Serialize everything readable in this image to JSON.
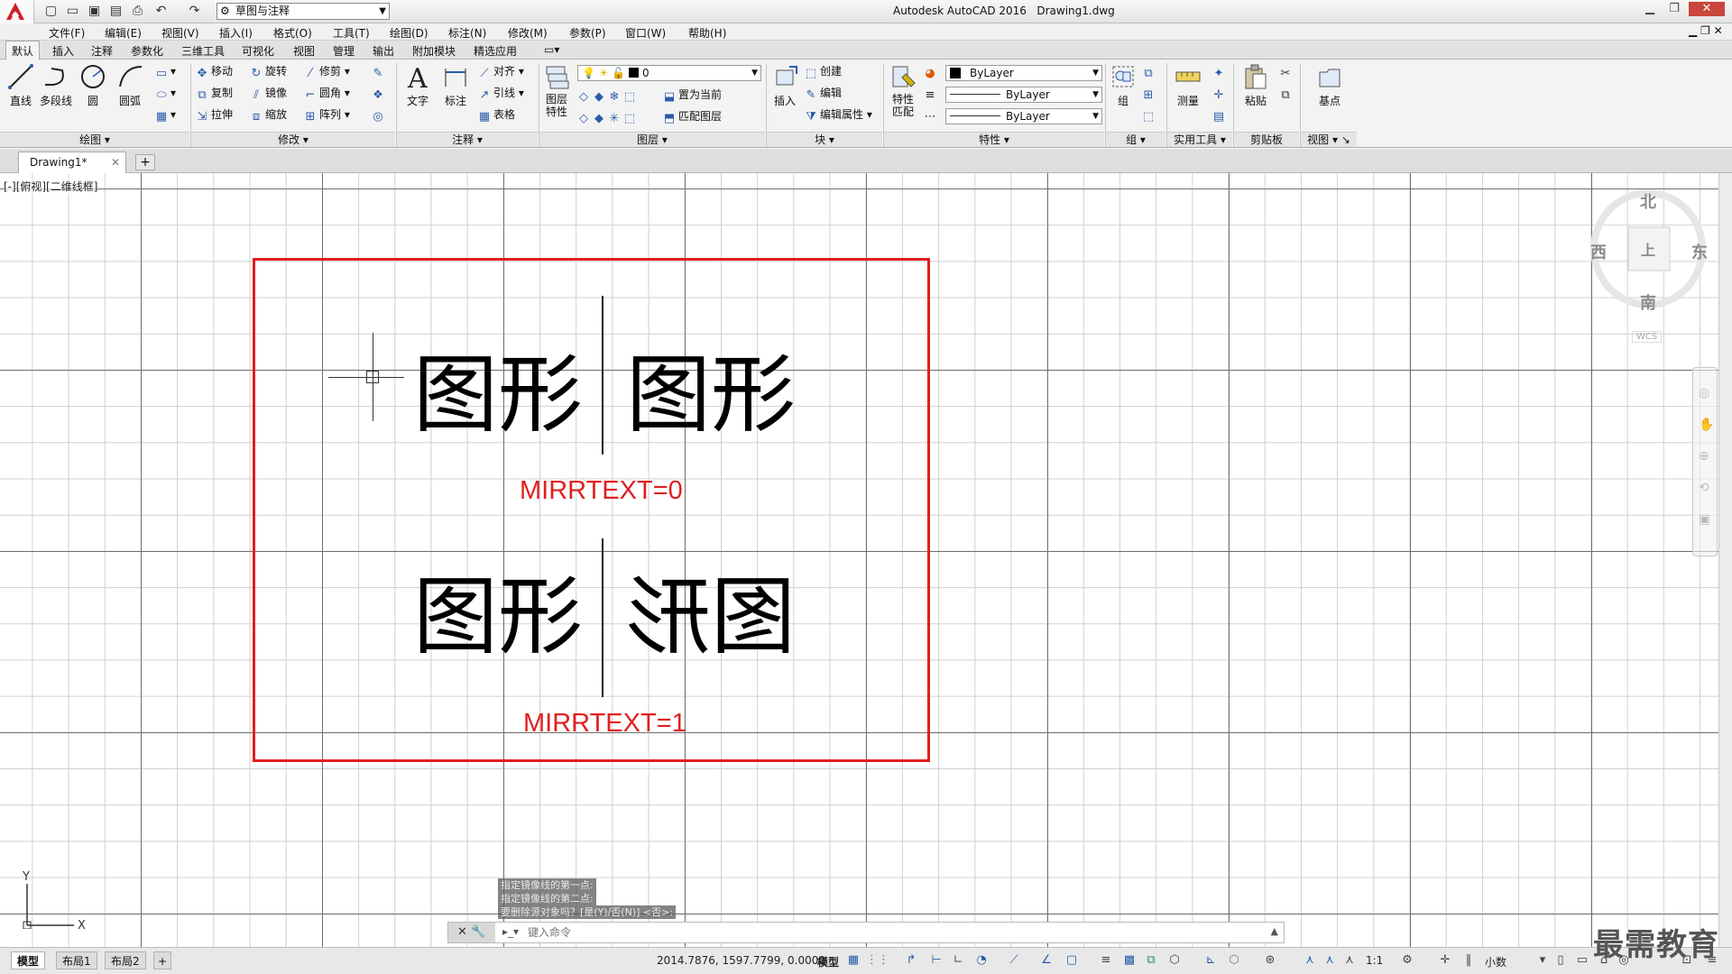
{
  "app": {
    "title": "Autodesk AutoCAD 2016",
    "file": "Drawing1.dwg",
    "workspace": "草图与注释"
  },
  "menus": [
    "文件(F)",
    "编辑(E)",
    "视图(V)",
    "插入(I)",
    "格式(O)",
    "工具(T)",
    "绘图(D)",
    "标注(N)",
    "修改(M)",
    "参数(P)",
    "窗口(W)",
    "帮助(H)"
  ],
  "ribbon_tabs": [
    "默认",
    "插入",
    "注释",
    "参数化",
    "三维工具",
    "可视化",
    "视图",
    "管理",
    "输出",
    "附加模块",
    "精选应用"
  ],
  "ribbon": {
    "draw": {
      "title": "绘图",
      "line": "直线",
      "pline": "多段线",
      "circle": "圆",
      "arc": "圆弧"
    },
    "modify": {
      "title": "修改",
      "move": "移动",
      "rotate": "旋转",
      "trim": "修剪",
      "copy": "复制",
      "mirror": "镜像",
      "fillet": "圆角",
      "stretch": "拉伸",
      "scale": "缩放",
      "array": "阵列"
    },
    "annotation": {
      "title": "注释",
      "text": "文字",
      "dim": "标注",
      "align": "对齐",
      "leader": "引线",
      "table": "表格"
    },
    "layers": {
      "title": "图层",
      "props": "图层特性",
      "current_layer": "0",
      "set_current": "置为当前",
      "match": "匹配图层"
    },
    "block": {
      "title": "块",
      "insert": "插入",
      "create": "创建",
      "edit": "编辑",
      "edit_attr": "编辑属性"
    },
    "properties": {
      "title": "特性",
      "match": "特性匹配",
      "color": "ByLayer",
      "linetype": "ByLayer",
      "lineweight": "ByLayer"
    },
    "groups": {
      "title": "组",
      "group": "组"
    },
    "utilities": {
      "title": "实用工具",
      "measure": "测量"
    },
    "clipboard": {
      "title": "剪贴板",
      "paste": "粘贴"
    },
    "view": {
      "title": "视图",
      "base": "基点"
    }
  },
  "doc_tab": "Drawing1*",
  "viewport_label": "[-][俯视][二维线框]",
  "drawing": {
    "text_top_left": "图形",
    "text_top_right": "图形",
    "label_top": "MIRRTEXT=0",
    "text_bottom_left": "图形",
    "text_bottom_right_mirrored": "图形",
    "label_bottom": "MIRRTEXT=1",
    "frame_color": "#e11f1f"
  },
  "viewcube": {
    "north": "北",
    "south": "南",
    "east": "东",
    "west": "西",
    "top": "上",
    "wcs": "WCS"
  },
  "command": {
    "history": [
      "指定镜像线的第一点:",
      "指定镜像线的第二点:",
      "要删除源对象吗？[是(Y)/否(N)] <否>:"
    ],
    "placeholder": "键入命令"
  },
  "layout_tabs": [
    "模型",
    "布局1",
    "布局2"
  ],
  "status": {
    "coords": "2014.7876, 1597.7799, 0.0000",
    "space": "模型",
    "scale": "1:1",
    "units": "小数"
  },
  "watermark": "最需教育"
}
